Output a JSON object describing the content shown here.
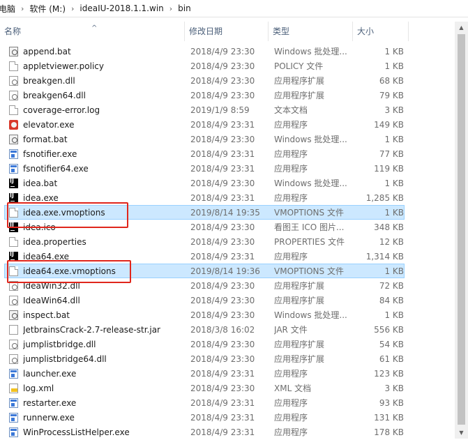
{
  "breadcrumb": [
    "电脑",
    "软件 (M:)",
    "ideaIU-2018.1.1.win",
    "bin"
  ],
  "columns": {
    "name": "名称",
    "date": "修改日期",
    "type": "类型",
    "size": "大小"
  },
  "files": [
    {
      "name": "append.bat",
      "date": "2018/4/9 23:30",
      "type": "Windows 批处理...",
      "size": "1 KB",
      "icon": "batch-icon"
    },
    {
      "name": "appletviewer.policy",
      "date": "2018/4/9 23:30",
      "type": "POLICY 文件",
      "size": "1 KB",
      "icon": "file-icon"
    },
    {
      "name": "breakgen.dll",
      "date": "2018/4/9 23:30",
      "type": "应用程序扩展",
      "size": "68 KB",
      "icon": "dll-icon"
    },
    {
      "name": "breakgen64.dll",
      "date": "2018/4/9 23:30",
      "type": "应用程序扩展",
      "size": "79 KB",
      "icon": "dll-icon"
    },
    {
      "name": "coverage-error.log",
      "date": "2019/1/9 8:59",
      "type": "文本文档",
      "size": "3 KB",
      "icon": "file-icon"
    },
    {
      "name": "elevator.exe",
      "date": "2018/4/9 23:31",
      "type": "应用程序",
      "size": "149 KB",
      "icon": "elevator-icon"
    },
    {
      "name": "format.bat",
      "date": "2018/4/9 23:30",
      "type": "Windows 批处理...",
      "size": "1 KB",
      "icon": "batch-icon"
    },
    {
      "name": "fsnotifier.exe",
      "date": "2018/4/9 23:31",
      "type": "应用程序",
      "size": "77 KB",
      "icon": "exe-icon"
    },
    {
      "name": "fsnotifier64.exe",
      "date": "2018/4/9 23:31",
      "type": "应用程序",
      "size": "119 KB",
      "icon": "exe-icon"
    },
    {
      "name": "idea.bat",
      "date": "2018/4/9 23:30",
      "type": "Windows 批处理...",
      "size": "1 KB",
      "icon": "intellij-icon"
    },
    {
      "name": "idea.exe",
      "date": "2018/4/9 23:31",
      "type": "应用程序",
      "size": "1,285 KB",
      "icon": "intellij-icon"
    },
    {
      "name": "idea.exe.vmoptions",
      "date": "2019/8/14 19:35",
      "type": "VMOPTIONS 文件",
      "size": "1 KB",
      "icon": "file-icon",
      "selected": true
    },
    {
      "name": "idea.ico",
      "date": "2018/4/9 23:30",
      "type": "看图王 ICO 图片...",
      "size": "348 KB",
      "icon": "intellij-icon"
    },
    {
      "name": "idea.properties",
      "date": "2018/4/9 23:30",
      "type": "PROPERTIES 文件",
      "size": "12 KB",
      "icon": "file-icon"
    },
    {
      "name": "idea64.exe",
      "date": "2018/4/9 23:31",
      "type": "应用程序",
      "size": "1,314 KB",
      "icon": "intellij-icon"
    },
    {
      "name": "idea64.exe.vmoptions",
      "date": "2019/8/14 19:36",
      "type": "VMOPTIONS 文件",
      "size": "1 KB",
      "icon": "file-icon",
      "selected": true
    },
    {
      "name": "IdeaWin32.dll",
      "date": "2018/4/9 23:30",
      "type": "应用程序扩展",
      "size": "72 KB",
      "icon": "dll-icon"
    },
    {
      "name": "IdeaWin64.dll",
      "date": "2018/4/9 23:30",
      "type": "应用程序扩展",
      "size": "84 KB",
      "icon": "dll-icon"
    },
    {
      "name": "inspect.bat",
      "date": "2018/4/9 23:30",
      "type": "Windows 批处理...",
      "size": "1 KB",
      "icon": "batch-icon"
    },
    {
      "name": "JetbrainsCrack-2.7-release-str.jar",
      "date": "2018/3/8 16:02",
      "type": "JAR 文件",
      "size": "556 KB",
      "icon": "jar-icon"
    },
    {
      "name": "jumplistbridge.dll",
      "date": "2018/4/9 23:30",
      "type": "应用程序扩展",
      "size": "54 KB",
      "icon": "dll-icon"
    },
    {
      "name": "jumplistbridge64.dll",
      "date": "2018/4/9 23:30",
      "type": "应用程序扩展",
      "size": "61 KB",
      "icon": "dll-icon"
    },
    {
      "name": "launcher.exe",
      "date": "2018/4/9 23:31",
      "type": "应用程序",
      "size": "123 KB",
      "icon": "exe-icon"
    },
    {
      "name": "log.xml",
      "date": "2018/4/9 23:30",
      "type": "XML 文档",
      "size": "3 KB",
      "icon": "xml-icon"
    },
    {
      "name": "restarter.exe",
      "date": "2018/4/9 23:31",
      "type": "应用程序",
      "size": "93 KB",
      "icon": "exe-icon"
    },
    {
      "name": "runnerw.exe",
      "date": "2018/4/9 23:31",
      "type": "应用程序",
      "size": "131 KB",
      "icon": "exe-icon"
    },
    {
      "name": "WinProcessListHelper.exe",
      "date": "2018/4/9 23:31",
      "type": "应用程序",
      "size": "178 KB",
      "icon": "exe-icon"
    }
  ],
  "colors": {
    "selection": "#cce8ff",
    "selection_border": "#99d1ff",
    "annotation": "#e0261c"
  }
}
